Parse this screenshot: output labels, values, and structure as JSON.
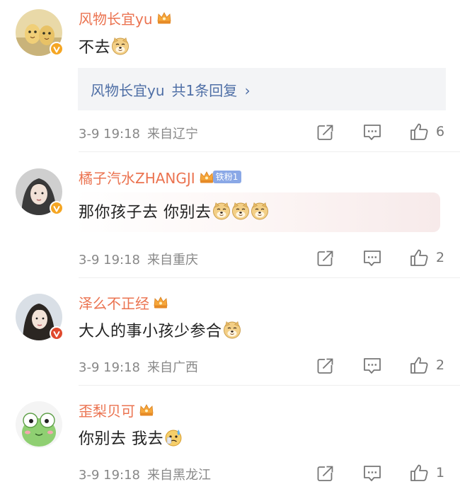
{
  "colors": {
    "username": "#eb7350",
    "link": "#4f6fa6",
    "meta": "#888888",
    "text": "#222222",
    "vip": "#e0492e",
    "fan_badge": "#8aa8e6"
  },
  "comments": [
    {
      "username": "风物长宜yu",
      "text": "不去",
      "emoji": "doge-emoji",
      "reply": {
        "author": "风物长宜yu",
        "summary": "共1条回复",
        "chevron": "›"
      },
      "date": "3-9 19:18",
      "location": "来自辽宁",
      "likes": "6"
    },
    {
      "username": "橘子汽水ZHANGJI",
      "fan_badge": "铁粉1",
      "text": "那你孩子去 你别去",
      "emoji": "doge-emoji x3",
      "date": "3-9 19:18",
      "location": "来自重庆",
      "likes": "2"
    },
    {
      "username": "泽么不正经",
      "text": "大人的事小孩少参合",
      "emoji": "doge-emoji",
      "date": "3-9 19:18",
      "location": "来自广西",
      "likes": "2"
    },
    {
      "username": "歪梨贝可",
      "text": "你别去 我去",
      "emoji": "sweat-emoji",
      "date": "3-9 19:18",
      "location": "来自黑龙江",
      "likes": "1"
    }
  ]
}
